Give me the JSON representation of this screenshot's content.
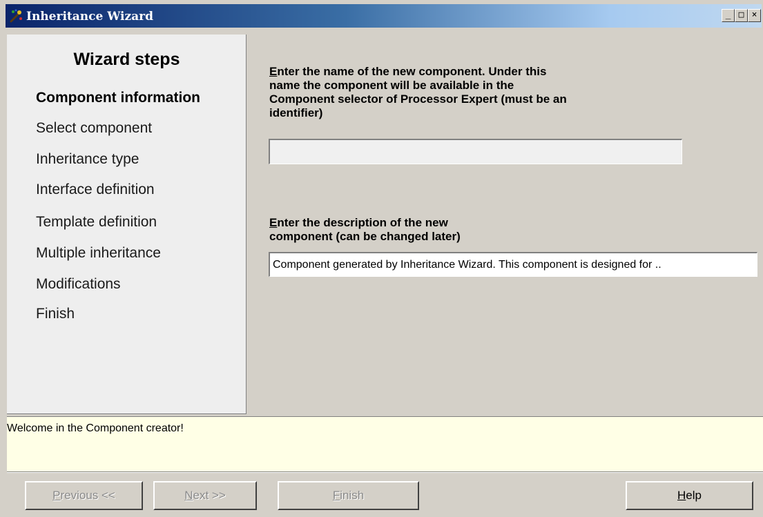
{
  "window": {
    "title": "Inheritance Wizard",
    "minimize_glyph": "_",
    "maximize_glyph": "□",
    "close_glyph": "×"
  },
  "sidebar": {
    "title": "Wizard steps",
    "steps": [
      {
        "label": "Component information",
        "active": true
      },
      {
        "label": "Select component"
      },
      {
        "label": "Inheritance type"
      },
      {
        "label": "Interface definition"
      },
      {
        "label": "Template definition"
      },
      {
        "label": "Multiple inheritance"
      },
      {
        "label": "Modifications"
      },
      {
        "label": "Finish"
      }
    ]
  },
  "form": {
    "name_label_hotkey": "E",
    "name_label_rest_1": "nter the name of the new component. Under this",
    "name_label_line2": "name the component will be available in the",
    "name_label_line3": "Component selector of Processor Expert (must be an",
    "name_label_line4": "identifier)",
    "name_value": "",
    "desc_label_hotkey": "E",
    "desc_label_rest_1": "nter the description of the new",
    "desc_label_line2": "component (can be changed later)",
    "desc_value": "Component generated by Inheritance Wizard. This component is designed for .."
  },
  "info": {
    "message": "Welcome in the Component creator!"
  },
  "buttons": {
    "previous_hotkey": "P",
    "previous_rest": "revious <<",
    "next_hotkey": "N",
    "next_rest": "ext >>",
    "finish_hotkey": "F",
    "finish_rest": "inish",
    "help_hotkey": "H",
    "help_rest": "elp"
  },
  "colors": {
    "window_bg": "#d4d0c8",
    "sidebar_bg": "#eeeeee",
    "info_bg": "#ffffe6",
    "title_start": "#0a246a",
    "title_end": "#a6caf0"
  },
  "icons": {
    "app": "wizard-wand-icon"
  }
}
